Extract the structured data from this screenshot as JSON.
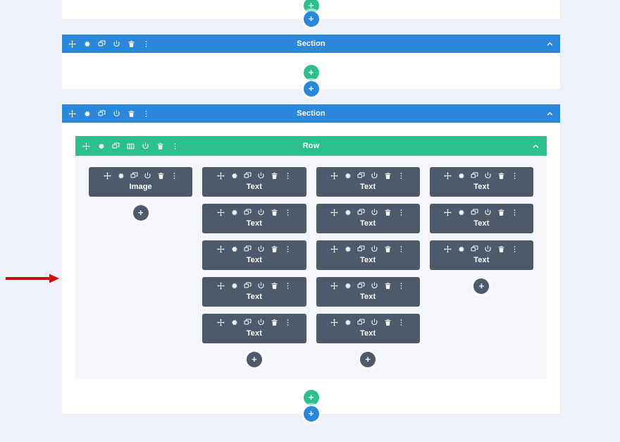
{
  "page": {
    "background_color": "#eef1f7",
    "card_color": "#ffffff",
    "row_background_color": "#f4f6fa"
  },
  "colors": {
    "section_bar": "#2b87da",
    "row_bar": "#2ec08b",
    "module": "#4c5a6b",
    "add_dark": "#4c5a6b",
    "add_green": "#2ec08b",
    "add_blue": "#2b87da",
    "annotation_arrow": "#cc1111"
  },
  "icon_names": {
    "move": "move-icon",
    "settings": "gear-icon",
    "duplicate": "duplicate-icon",
    "columns": "columns-icon",
    "save_to_library": "power-icon",
    "delete": "trash-icon",
    "more": "more-options-icon",
    "collapse": "chevron-up-icon",
    "add": "plus-icon"
  },
  "add_button_label": "+",
  "top_card": {
    "corner_add_label": "+",
    "add_module_label": "+",
    "add_section_label": "+"
  },
  "sections": [
    {
      "title": "Section",
      "tools": [
        "move-icon",
        "gear-icon",
        "duplicate-icon",
        "power-icon",
        "trash-icon",
        "more-options-icon"
      ],
      "collapse_icon": "chevron-up-icon",
      "add_row_label": "+",
      "add_section_label": "+",
      "rows": []
    },
    {
      "title": "Section",
      "tools": [
        "move-icon",
        "gear-icon",
        "duplicate-icon",
        "power-icon",
        "trash-icon",
        "more-options-icon"
      ],
      "collapse_icon": "chevron-up-icon",
      "add_row_label": "+",
      "add_section_label": "+",
      "rows": [
        {
          "title": "Row",
          "tools": [
            "move-icon",
            "gear-icon",
            "duplicate-icon",
            "columns-icon",
            "power-icon",
            "trash-icon",
            "more-options-icon"
          ],
          "collapse_icon": "chevron-up-icon",
          "columns": [
            {
              "add_module_label": "+",
              "modules": [
                {
                  "label": "Image",
                  "tools": [
                    "move-icon",
                    "gear-icon",
                    "duplicate-icon",
                    "power-icon",
                    "trash-icon",
                    "more-options-icon"
                  ]
                }
              ]
            },
            {
              "add_module_label": "+",
              "modules": [
                {
                  "label": "Text",
                  "tools": [
                    "move-icon",
                    "gear-icon",
                    "duplicate-icon",
                    "power-icon",
                    "trash-icon",
                    "more-options-icon"
                  ]
                },
                {
                  "label": "Text",
                  "tools": [
                    "move-icon",
                    "gear-icon",
                    "duplicate-icon",
                    "power-icon",
                    "trash-icon",
                    "more-options-icon"
                  ]
                },
                {
                  "label": "Text",
                  "tools": [
                    "move-icon",
                    "gear-icon",
                    "duplicate-icon",
                    "power-icon",
                    "trash-icon",
                    "more-options-icon"
                  ]
                },
                {
                  "label": "Text",
                  "tools": [
                    "move-icon",
                    "gear-icon",
                    "duplicate-icon",
                    "power-icon",
                    "trash-icon",
                    "more-options-icon"
                  ]
                },
                {
                  "label": "Text",
                  "tools": [
                    "move-icon",
                    "gear-icon",
                    "duplicate-icon",
                    "power-icon",
                    "trash-icon",
                    "more-options-icon"
                  ]
                }
              ]
            },
            {
              "add_module_label": "+",
              "modules": [
                {
                  "label": "Text",
                  "tools": [
                    "move-icon",
                    "gear-icon",
                    "duplicate-icon",
                    "power-icon",
                    "trash-icon",
                    "more-options-icon"
                  ]
                },
                {
                  "label": "Text",
                  "tools": [
                    "move-icon",
                    "gear-icon",
                    "duplicate-icon",
                    "power-icon",
                    "trash-icon",
                    "more-options-icon"
                  ]
                },
                {
                  "label": "Text",
                  "tools": [
                    "move-icon",
                    "gear-icon",
                    "duplicate-icon",
                    "power-icon",
                    "trash-icon",
                    "more-options-icon"
                  ]
                },
                {
                  "label": "Text",
                  "tools": [
                    "move-icon",
                    "gear-icon",
                    "duplicate-icon",
                    "power-icon",
                    "trash-icon",
                    "more-options-icon"
                  ]
                },
                {
                  "label": "Text",
                  "tools": [
                    "move-icon",
                    "gear-icon",
                    "duplicate-icon",
                    "power-icon",
                    "trash-icon",
                    "more-options-icon"
                  ]
                }
              ]
            },
            {
              "add_module_label": "+",
              "modules": [
                {
                  "label": "Text",
                  "tools": [
                    "move-icon",
                    "gear-icon",
                    "duplicate-icon",
                    "power-icon",
                    "trash-icon",
                    "more-options-icon"
                  ]
                },
                {
                  "label": "Text",
                  "tools": [
                    "move-icon",
                    "gear-icon",
                    "duplicate-icon",
                    "power-icon",
                    "trash-icon",
                    "more-options-icon"
                  ]
                },
                {
                  "label": "Text",
                  "tools": [
                    "move-icon",
                    "gear-icon",
                    "duplicate-icon",
                    "power-icon",
                    "trash-icon",
                    "more-options-icon"
                  ]
                }
              ]
            }
          ]
        }
      ]
    }
  ],
  "annotation": {
    "type": "arrow",
    "direction": "right",
    "color": "#cc1111"
  }
}
